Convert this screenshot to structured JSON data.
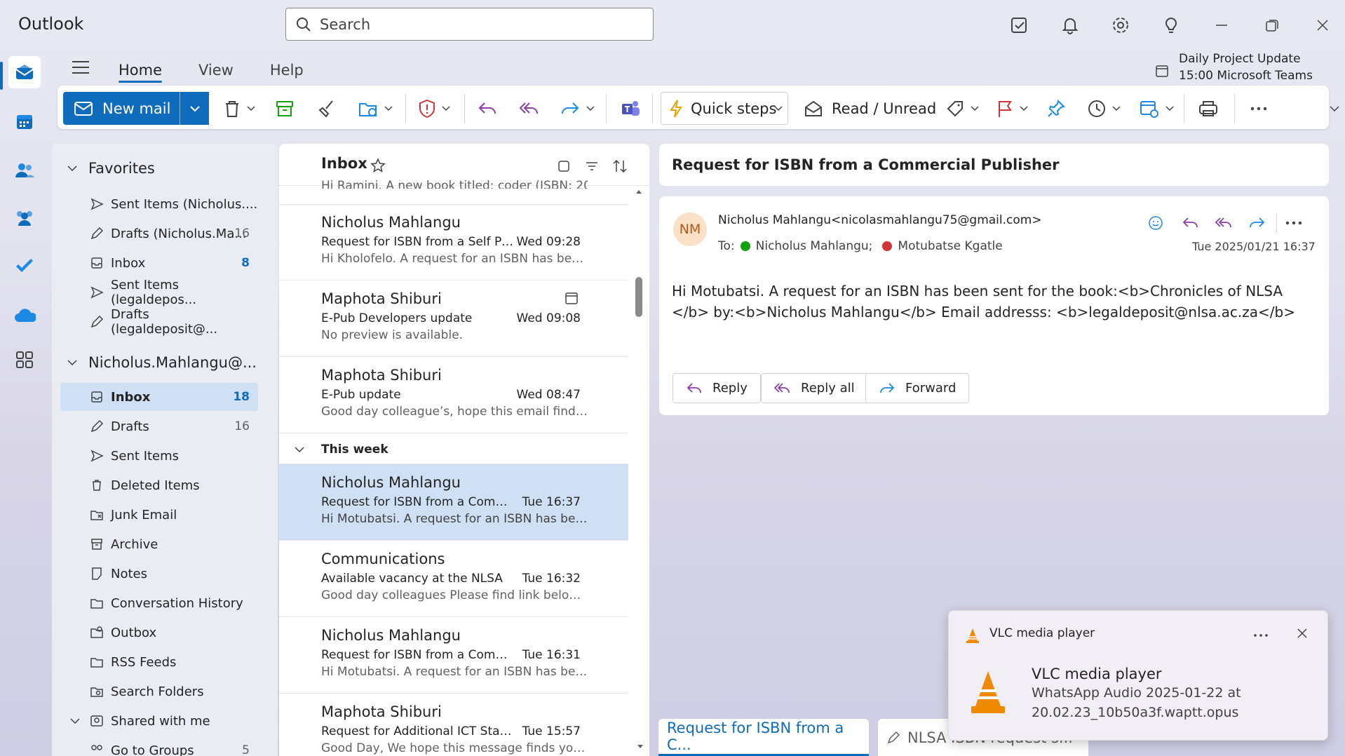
{
  "app": {
    "name": "Outlook"
  },
  "search": {
    "placeholder": "Search"
  },
  "tabs": [
    "Home",
    "View",
    "Help"
  ],
  "meeting": {
    "title": "Daily Project Update",
    "detail": "15:00 Microsoft Teams Meeting"
  },
  "ribbon": {
    "new_mail": "New mail",
    "quick_steps": "Quick steps",
    "read_unread": "Read / Unread"
  },
  "favorites": {
    "header": "Favorites",
    "items": [
      {
        "label": "Sent Items (Nicholus....",
        "count": ""
      },
      {
        "label": "Drafts (Nicholus.Ma...",
        "count": "16"
      },
      {
        "label": "Inbox",
        "count": "8"
      },
      {
        "label": "Sent Items (legaldepos...",
        "count": ""
      },
      {
        "label": "Drafts (legaldeposit@...",
        "count": ""
      }
    ]
  },
  "account": {
    "header": "Nicholus.Mahlangu@...",
    "items": [
      {
        "label": "Inbox",
        "count": "18"
      },
      {
        "label": "Drafts",
        "count": "16"
      },
      {
        "label": "Sent Items",
        "count": ""
      },
      {
        "label": "Deleted Items",
        "count": ""
      },
      {
        "label": "Junk Email",
        "count": ""
      },
      {
        "label": "Archive",
        "count": ""
      },
      {
        "label": "Notes",
        "count": ""
      },
      {
        "label": "Conversation History",
        "count": ""
      },
      {
        "label": "Outbox",
        "count": ""
      },
      {
        "label": "RSS Feeds",
        "count": ""
      },
      {
        "label": "Search Folders",
        "count": ""
      }
    ],
    "shared": "Shared with me",
    "groups": "Go to Groups",
    "groups_count": "5"
  },
  "list": {
    "title": "Inbox",
    "partial_preview": "Hi Ramini. A new book titled: coder (ISBN: 20...",
    "week_header": "This week",
    "messages": [
      {
        "from": "Nicholus Mahlangu",
        "subject": "Request for ISBN from a Self Pu...",
        "time": "Wed 09:28",
        "preview": "Hi Kholofelo. A request for an ISBN has been..."
      },
      {
        "from": "Maphota Shiburi",
        "subject": "E-Pub Developers update",
        "time": "Wed 09:08",
        "preview": "No preview is available."
      },
      {
        "from": "Maphota Shiburi",
        "subject": "E-Pub update",
        "time": "Wed 08:47",
        "preview": "Good day colleague’s, hope this email finds y..."
      },
      {
        "from": "Nicholus Mahlangu",
        "subject": "Request for ISBN from a Comme...",
        "time": "Tue 16:37",
        "preview": "Hi Motubatsi. A request for an ISBN has bee..."
      },
      {
        "from": "Communications",
        "subject": "Available vacancy at the NLSA",
        "time": "Tue 16:32",
        "preview": "Good day colleagues Please find link below v..."
      },
      {
        "from": "Nicholus Mahlangu",
        "subject": "Request for ISBN from a Comme...",
        "time": "Tue 16:31",
        "preview": "Hi Motubatsi. A request for an ISBN has bee..."
      },
      {
        "from": "Maphota Shiburi",
        "subject": "Request for Additional ICT Staff ...",
        "time": "Tue 15:57",
        "preview": "Good Day, We hope this message finds you ..."
      }
    ]
  },
  "reading": {
    "subject": "Request for ISBN from a Commercial Publisher",
    "initials": "NM",
    "sender": "Nicholus Mahlangu<nicolasmahlangu75@gmail.com>",
    "to_label": "To:",
    "to1": "Nicholus Mahlangu;",
    "to2": "Motubatse Kgatle",
    "date": "Tue 2025/01/21 16:37",
    "body": "Hi Motubatsi. A request for an ISBN has been sent for the book:<b>Chronicles of NLSA </b> by:<b>Nicholus Mahlangu</b> Email addresss: <b>legaldeposit@nlsa.ac.za</b>",
    "reply": "Reply",
    "reply_all": "Reply all",
    "forward": "Forward"
  },
  "bottom_tabs": [
    "Request for ISBN from a C...",
    "NLSA ISBN request s..."
  ],
  "toast": {
    "app": "VLC media player",
    "title": "VLC media player",
    "line1": "WhatsApp Audio 2025-01-22 at",
    "line2": "20.02.23_10b50a3f.waptt.opus"
  },
  "colors": {
    "accent": "#0f6cbd",
    "selected": "#cfe0f5",
    "presence_green": "#13a10e",
    "presence_red": "#d13438"
  }
}
